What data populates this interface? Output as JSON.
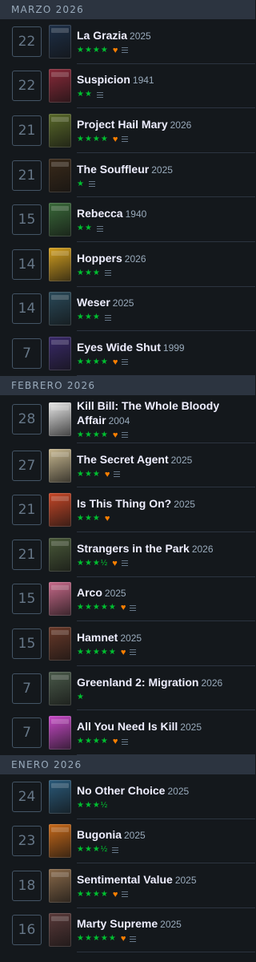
{
  "months": [
    {
      "label": "MARZO 2026",
      "entries": [
        {
          "day": "22",
          "title": "La Grazia",
          "year": "2025",
          "rating": "★★★★",
          "liked": true,
          "review": true,
          "poster_color": "#1e3048"
        },
        {
          "day": "22",
          "title": "Suspicion",
          "year": "1941",
          "rating": "★★",
          "liked": false,
          "review": true,
          "poster_color": "#8a2a3a"
        },
        {
          "day": "21",
          "title": "Project Hail Mary",
          "year": "2026",
          "rating": "★★★★",
          "liked": true,
          "review": true,
          "poster_color": "#5a6a2a"
        },
        {
          "day": "21",
          "title": "The Souffleur",
          "year": "2025",
          "rating": "★",
          "liked": false,
          "review": true,
          "poster_color": "#3a2a1a"
        },
        {
          "day": "15",
          "title": "Rebecca",
          "year": "1940",
          "rating": "★★",
          "liked": false,
          "review": true,
          "poster_color": "#3a6a3a"
        },
        {
          "day": "14",
          "title": "Hoppers",
          "year": "2026",
          "rating": "★★★",
          "liked": false,
          "review": true,
          "poster_color": "#d4a020"
        },
        {
          "day": "14",
          "title": "Weser",
          "year": "2025",
          "rating": "★★★",
          "liked": false,
          "review": true,
          "poster_color": "#2a4a5a"
        },
        {
          "day": "7",
          "title": "Eyes Wide Shut",
          "year": "1999",
          "rating": "★★★★",
          "liked": true,
          "review": true,
          "poster_color": "#3a2a6a"
        }
      ]
    },
    {
      "label": "FEBRERO 2026",
      "entries": [
        {
          "day": "28",
          "title": "Kill Bill: The Whole Bloody Affair",
          "year": "2004",
          "rating": "★★★★",
          "liked": true,
          "review": true,
          "poster_color": "#e8e8e8"
        },
        {
          "day": "27",
          "title": "The Secret Agent",
          "year": "2025",
          "rating": "★★★",
          "liked": true,
          "review": true,
          "poster_color": "#c8b890"
        },
        {
          "day": "21",
          "title": "Is This Thing On?",
          "year": "2025",
          "rating": "★★★",
          "liked": true,
          "review": false,
          "poster_color": "#c84828"
        },
        {
          "day": "21",
          "title": "Strangers in the Park",
          "year": "2026",
          "rating": "★★★½",
          "liked": true,
          "review": true,
          "poster_color": "#4a5a3a"
        },
        {
          "day": "15",
          "title": "Arco",
          "year": "2025",
          "rating": "★★★★★",
          "liked": true,
          "review": true,
          "poster_color": "#c86a8a"
        },
        {
          "day": "15",
          "title": "Hamnet",
          "year": "2025",
          "rating": "★★★★★",
          "liked": true,
          "review": true,
          "poster_color": "#6a3a2a"
        },
        {
          "day": "7",
          "title": "Greenland 2: Migration",
          "year": "2026",
          "rating": "★",
          "liked": false,
          "review": false,
          "poster_color": "#4a5a4a"
        },
        {
          "day": "7",
          "title": "All You Need Is Kill",
          "year": "2025",
          "rating": "★★★★",
          "liked": true,
          "review": true,
          "poster_color": "#c84ac8"
        }
      ]
    },
    {
      "label": "ENERO 2026",
      "entries": [
        {
          "day": "24",
          "title": "No Other Choice",
          "year": "2025",
          "rating": "★★★½",
          "liked": false,
          "review": false,
          "poster_color": "#2a5a7a"
        },
        {
          "day": "23",
          "title": "Bugonia",
          "year": "2025",
          "rating": "★★★½",
          "liked": false,
          "review": true,
          "poster_color": "#c86a1a"
        },
        {
          "day": "18",
          "title": "Sentimental Value",
          "year": "2025",
          "rating": "★★★★",
          "liked": true,
          "review": true,
          "poster_color": "#8a6a4a"
        },
        {
          "day": "16",
          "title": "Marty Supreme",
          "year": "2025",
          "rating": "★★★★★",
          "liked": true,
          "review": true,
          "poster_color": "#5a3a3a"
        }
      ]
    }
  ]
}
